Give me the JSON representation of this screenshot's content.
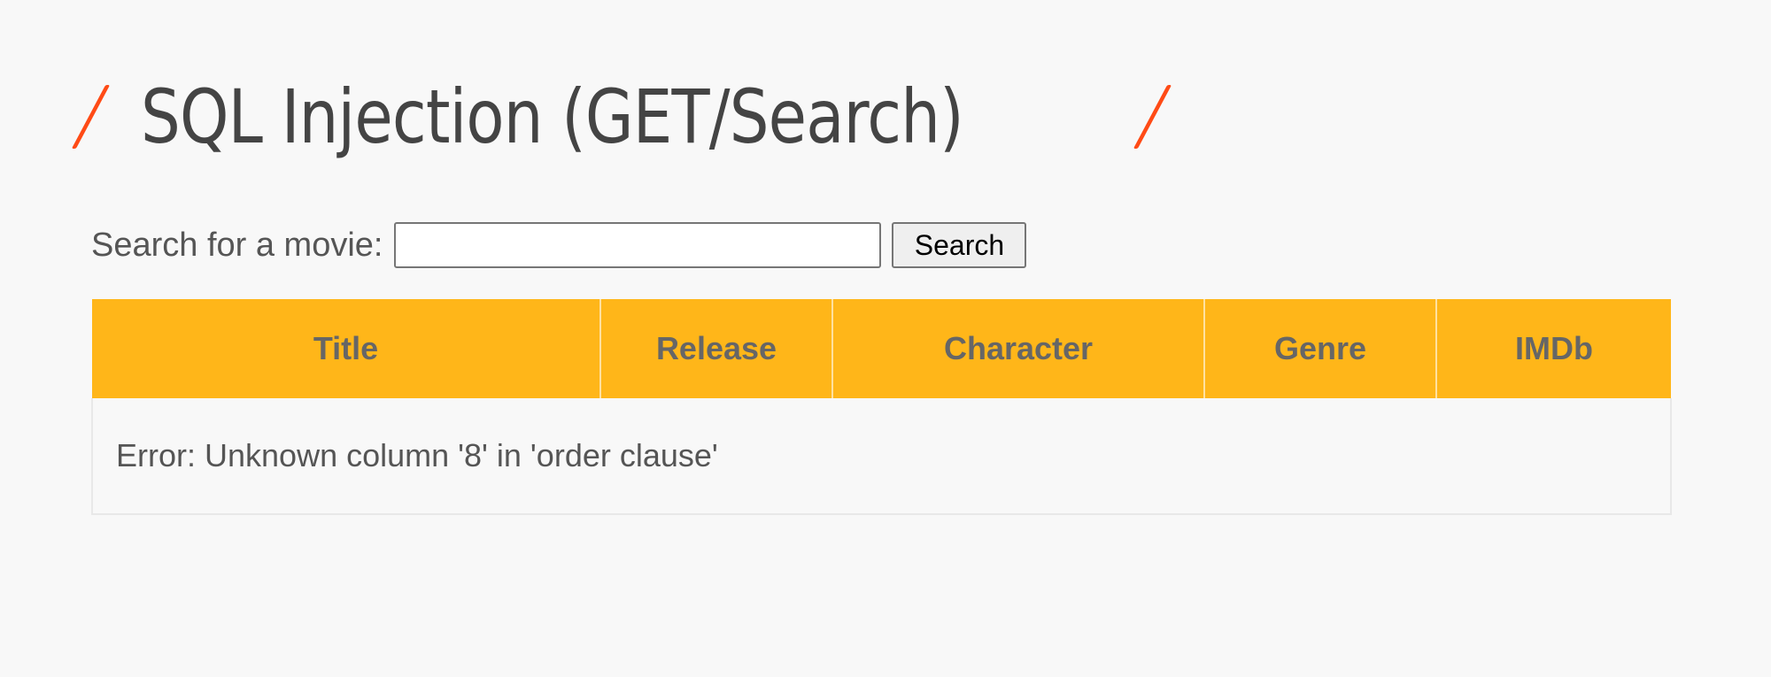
{
  "header": {
    "title": "SQL Injection (GET/Search)",
    "accent_color": "#ff4b16",
    "left_decoration_icon": "slash-icon",
    "right_decoration_icon": "slash-icon"
  },
  "search": {
    "label": "Search for a movie:",
    "value": "",
    "placeholder": "",
    "button_label": "Search"
  },
  "table": {
    "header_color": "#ffb619",
    "columns": [
      "Title",
      "Release",
      "Character",
      "Genre",
      "IMDb"
    ],
    "message": "Error: Unknown column '8' in 'order clause'"
  }
}
